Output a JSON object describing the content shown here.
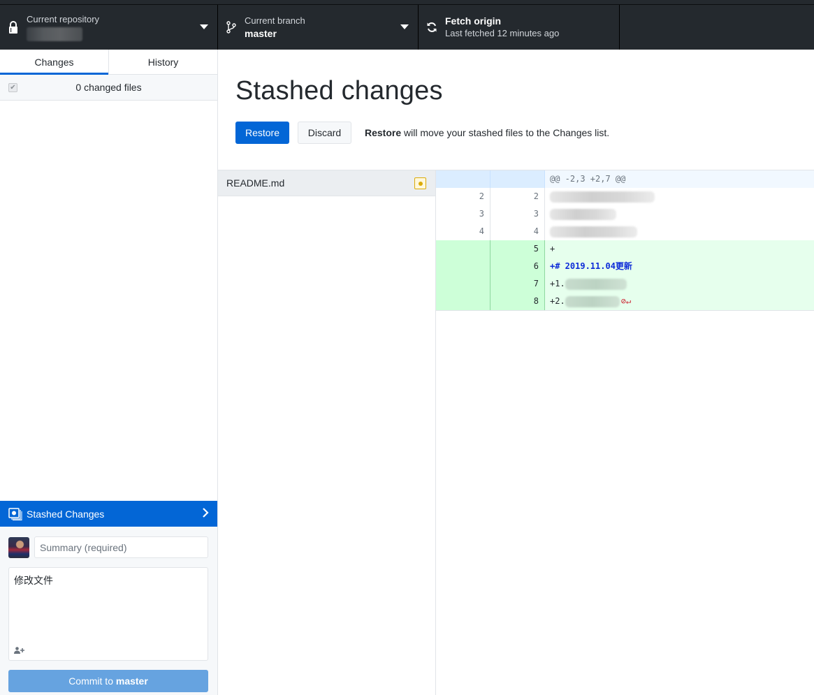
{
  "toolbar": {
    "repository": {
      "label": "Current repository",
      "value": ""
    },
    "branch": {
      "label": "Current branch",
      "value": "master"
    },
    "fetch": {
      "label": "Fetch origin",
      "status": "Last fetched 12 minutes ago"
    }
  },
  "sidebar": {
    "tabs": [
      {
        "label": "Changes",
        "active": true
      },
      {
        "label": "History",
        "active": false
      }
    ],
    "changes_count": "0 changed files",
    "stash_bar": {
      "label": "Stashed Changes"
    },
    "commit": {
      "summary_placeholder": "Summary (required)",
      "summary_value": "",
      "description_value": "修改文件",
      "button_prefix": "Commit to ",
      "button_branch": "master"
    }
  },
  "main": {
    "title": "Stashed changes",
    "restore_label": "Restore",
    "discard_label": "Discard",
    "note_bold": "Restore",
    "note_rest": " will move your stashed files to the Changes list.",
    "files": [
      {
        "name": "README.md",
        "status": "modified"
      }
    ],
    "diff": {
      "hunk_header": "@@ -2,3 +2,7 @@",
      "lines": [
        {
          "type": "context",
          "old": "2",
          "new": "2",
          "text": ""
        },
        {
          "type": "context",
          "old": "3",
          "new": "3",
          "text": ""
        },
        {
          "type": "context",
          "old": "4",
          "new": "4",
          "text": ""
        },
        {
          "type": "add",
          "old": "",
          "new": "5",
          "text": "+"
        },
        {
          "type": "add",
          "old": "",
          "new": "6",
          "text": "+# 2019.11.04更新"
        },
        {
          "type": "add",
          "old": "",
          "new": "7",
          "text": "+1."
        },
        {
          "type": "add",
          "old": "",
          "new": "8",
          "text": "+2."
        }
      ]
    }
  },
  "colors": {
    "accent": "#0366d6",
    "toolbar_bg": "#24292e",
    "added_bg": "#e6ffed",
    "added_gutter": "#cdffd8",
    "hunk_bg": "#f1f8ff",
    "modified": "#dbab09"
  }
}
